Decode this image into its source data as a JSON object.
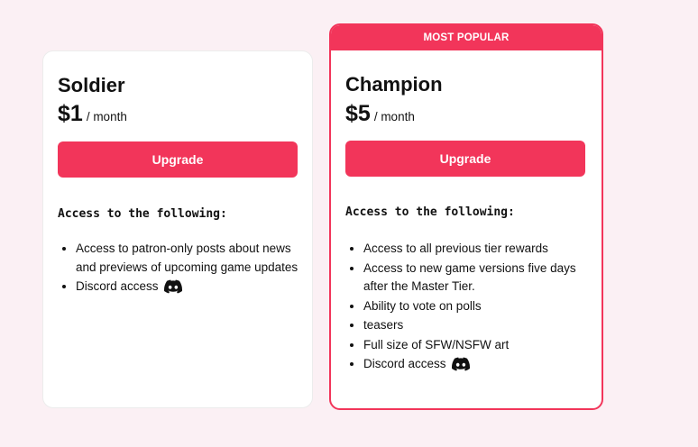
{
  "tiers": [
    {
      "name": "Soldier",
      "price": "$1",
      "period": "/ month",
      "button_label": "Upgrade",
      "access_heading": "Access to the following:",
      "benefits": [
        "Access to patron-only posts about news and previews of upcoming game updates",
        "Discord access"
      ]
    },
    {
      "badge": "MOST POPULAR",
      "name": "Champion",
      "price": "$5",
      "period": "/ month",
      "button_label": "Upgrade",
      "access_heading": "Access to the following:",
      "benefits": [
        "Access to all previous tier rewards",
        "Access to new game versions five days after the Master Tier.",
        "Ability to vote on polls",
        "teasers",
        "Full size of SFW/NSFW art",
        "Discord access"
      ]
    }
  ],
  "icons": {
    "discord": "discord-icon"
  },
  "colors": {
    "accent": "#f2355a",
    "background": "#fbf0f4"
  }
}
